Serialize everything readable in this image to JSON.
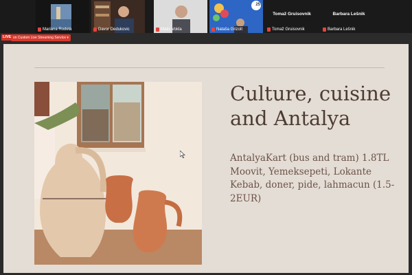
{
  "participants": [
    {
      "name": "Mariana Rodela"
    },
    {
      "name": "Davor Dedukovic"
    },
    {
      "name": "Matic Vokla"
    },
    {
      "name": "Nataša Grizolt"
    },
    {
      "name": "Tomaž Gruisovnik"
    },
    {
      "name": "Barbara Lešnik"
    }
  ],
  "clock_badge": "25",
  "live": {
    "badge": "LIVE",
    "label": "on Custom Live Streaming Service"
  },
  "slide": {
    "title_line1": "Culture, cuisine",
    "title_line2": "and Antalya",
    "body_lines": [
      "AntalyaKart (bus and tram) 1.8TL",
      "Moovit, Yemeksepeti, Lokante",
      "Kebab, doner, pide, lahmacun (1.5-",
      "2EUR)"
    ]
  },
  "colors": {
    "slide_bg": "#e4ddd5",
    "title_text": "#4d3c33",
    "body_text": "#6b5248",
    "live_red": "#d8352a"
  }
}
